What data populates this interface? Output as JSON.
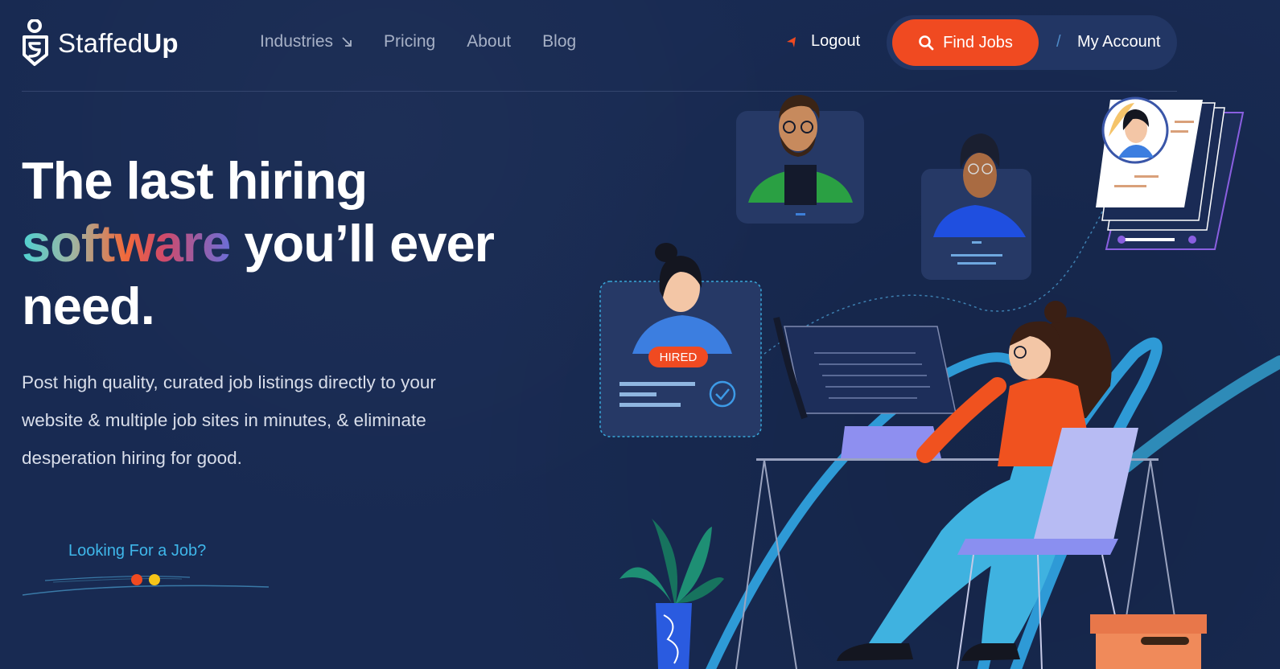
{
  "brand": {
    "name_part1": "Staffed",
    "name_part2": "Up",
    "accent_color": "#f04a21",
    "background_color": "#182a52"
  },
  "nav": {
    "items": [
      {
        "label": "Industries",
        "icon": "arrow-down-right-icon"
      },
      {
        "label": "Pricing"
      },
      {
        "label": "About"
      },
      {
        "label": "Blog"
      }
    ]
  },
  "header_actions": {
    "logout_label": "Logout",
    "logout_icon": "cursor-pointer-icon",
    "find_jobs_label": "Find Jobs",
    "find_jobs_icon": "search-icon",
    "separator": "/",
    "my_account_label": "My Account"
  },
  "hero": {
    "headline_line1": "The last hiring",
    "headline_highlight": "software",
    "headline_line2_rest": " you’ll ever",
    "headline_line3": "need.",
    "subtext": "Post high quality, curated job listings directly to your website & multiple job sites in minutes, & eliminate desperation hiring for good.",
    "job_link_label": "Looking For a Job?"
  },
  "illustration": {
    "hired_badge": "HIRED"
  }
}
